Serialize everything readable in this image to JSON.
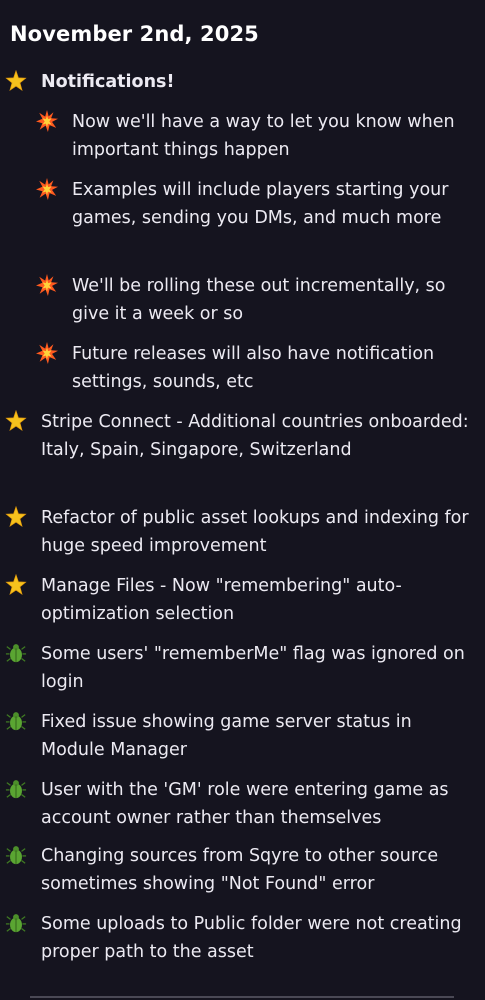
{
  "date_heading": "November 2nd, 2025",
  "icons": {
    "star": "sparkle-star-icon",
    "boom": "collision-icon",
    "bug": "bug-icon"
  },
  "colors": {
    "background": "#15141f",
    "text": "#eceaf2",
    "star": "#f6c21d",
    "boom": "#ff6a1a",
    "bug": "#5aa532"
  },
  "items": [
    {
      "icon": "star",
      "text": "Notifications!"
    },
    {
      "icon": "boom",
      "text": "Now we'll have a way to let you know when important things happen"
    },
    {
      "icon": "boom",
      "text": "Examples will include players starting your games, sending you DMs, and much more"
    },
    {
      "icon": "boom",
      "text": "We'll be rolling these out incrementally, so give it a week or so"
    },
    {
      "icon": "boom",
      "text": "Future releases will also have notification settings, sounds, etc"
    },
    {
      "icon": "star",
      "text": "Stripe Connect - Additional countries onboarded: Italy, Spain, Singapore, Switzerland"
    },
    {
      "icon": "star",
      "text": "Refactor of public asset lookups and indexing for huge speed improvement"
    },
    {
      "icon": "star",
      "text": "Manage Files - Now \"remembering\" auto-optimization selection"
    },
    {
      "icon": "bug",
      "text": "Some users' \"rememberMe\" flag was ignored on login"
    },
    {
      "icon": "bug",
      "text": "Fixed issue showing game server status in Module Manager"
    },
    {
      "icon": "bug",
      "text": "User with the 'GM' role were entering game as account owner rather than themselves"
    },
    {
      "icon": "bug",
      "text": "Changing sources from Sqyre to other source sometimes showing \"Not Found\" error"
    },
    {
      "icon": "bug",
      "text": "Some uploads to Public folder were not creating proper path to the asset"
    }
  ]
}
